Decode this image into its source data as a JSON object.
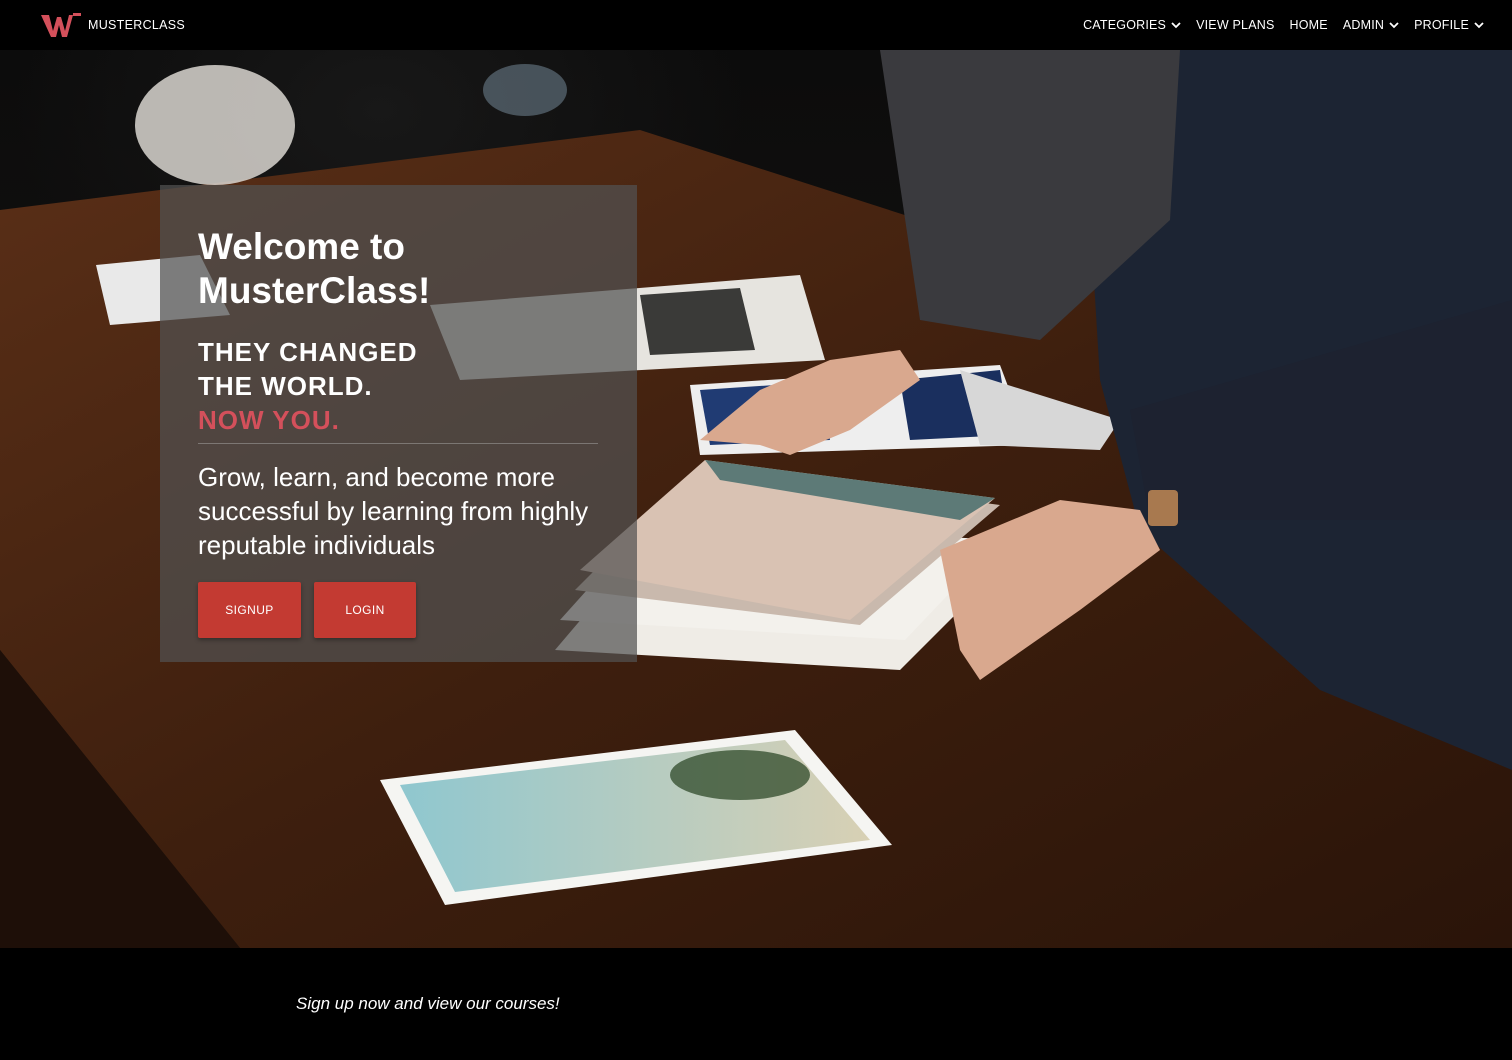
{
  "brand": {
    "name": "MUSTERCLASS",
    "logo_icon": "musterclass-logo-icon",
    "accent_color": "#d4505b"
  },
  "nav": {
    "categories": "CATEGORIES",
    "view_plans": "VIEW PLANS",
    "home": "HOME",
    "admin": "ADMIN",
    "profile": "PROFILE"
  },
  "hero": {
    "title": "Welcome to MusterClass!",
    "tagline_line1": "THEY CHANGED",
    "tagline_line2": "THE WORLD.",
    "tagline_highlight": "NOW YOU.",
    "description": "Grow, learn, and become more successful by learning from highly reputable individuals",
    "signup_label": "SIGNUP",
    "login_label": "LOGIN",
    "button_color": "#c33a32"
  },
  "footer": {
    "text": "Sign up now and view our courses!"
  }
}
